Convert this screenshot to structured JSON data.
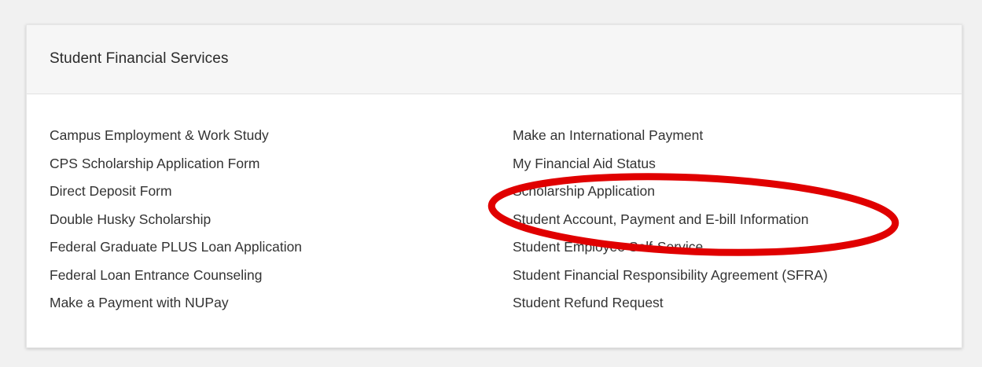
{
  "card": {
    "title": "Student Financial Services"
  },
  "links_left": [
    "Campus Employment & Work Study",
    "CPS Scholarship Application Form",
    "Direct Deposit Form",
    "Double Husky Scholarship",
    "Federal Graduate PLUS Loan Application",
    "Federal Loan Entrance Counseling",
    "Make a Payment with NUPay"
  ],
  "links_right": [
    "Make an International Payment",
    "My Financial Aid Status",
    "Scholarship Application",
    "Student Account, Payment and E-bill Information",
    "Student Employee Self-Service",
    "Student Financial Responsibility Agreement (SFRA)",
    "Student Refund Request"
  ],
  "colors": {
    "page_bg": "#f1f1f1",
    "header_bg": "#f6f6f6",
    "link_text": "#333333",
    "annotation_circle": "#e00000"
  }
}
